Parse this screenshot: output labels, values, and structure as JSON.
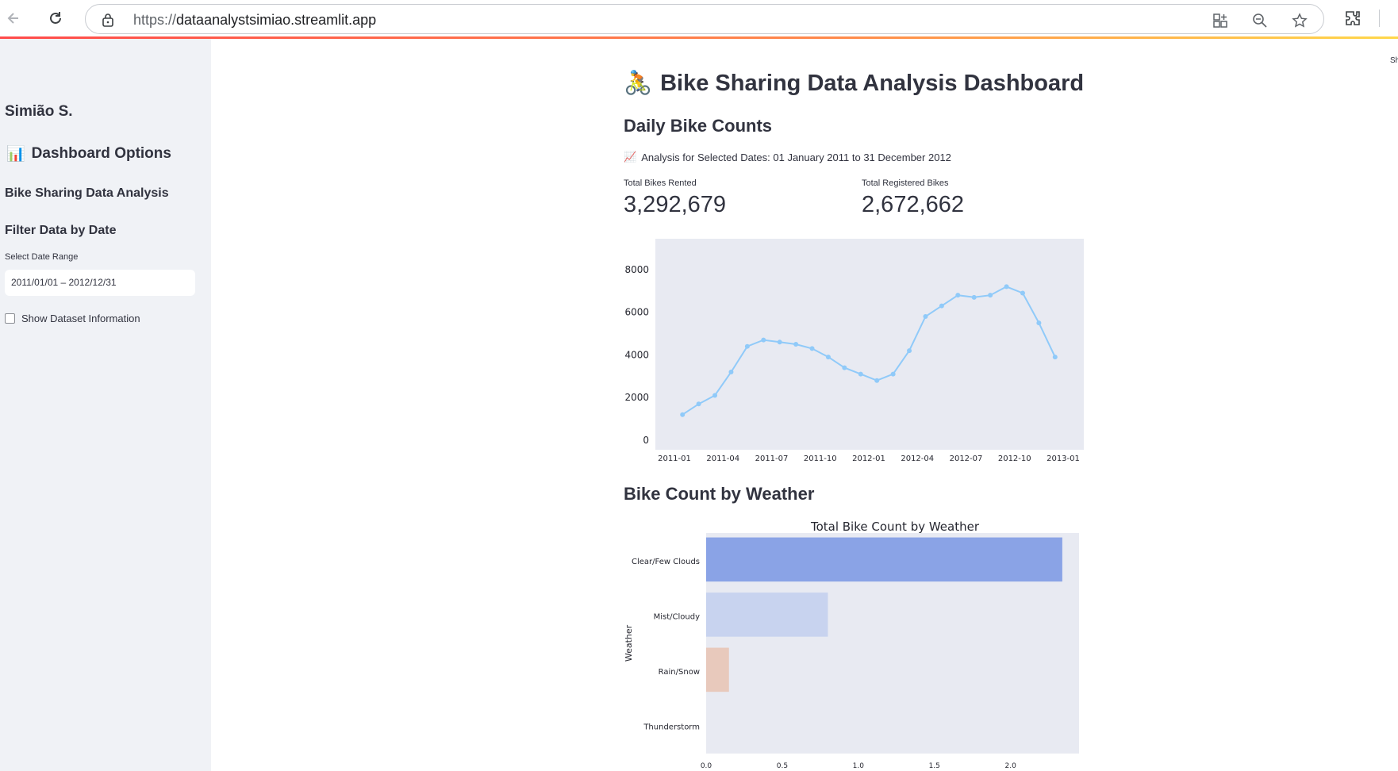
{
  "browser": {
    "url_prefix": "https://",
    "url_domain": "dataanalystsimiao.streamlit.app",
    "icons": [
      "back-arrow-icon",
      "reload-icon",
      "lock-icon",
      "apps-icon",
      "zoom-icon",
      "star-icon",
      "extensions-icon"
    ]
  },
  "sidebar": {
    "author": "Simião S.",
    "options_icon": "📊",
    "options_title": "Dashboard Options",
    "section_title": "Bike Sharing Data Analysis",
    "filter_title": "Filter Data by Date",
    "date_label": "Select Date Range",
    "date_value": "2011/01/01 – 2012/12/31",
    "checkbox_label": "Show Dataset Information",
    "checkbox_checked": false
  },
  "main": {
    "title_icon": "🚴",
    "title": "Bike Sharing Data Analysis Dashboard",
    "daily_heading": "Daily Bike Counts",
    "caption_icon": "📈",
    "caption": "Analysis for Selected Dates: 01 January 2011 to 31 December 2012",
    "metrics": [
      {
        "label": "Total Bikes Rented",
        "value": "3,292,679"
      },
      {
        "label": "Total Registered Bikes",
        "value": "2,672,662"
      }
    ],
    "weather_heading": "Bike Count by Weather",
    "top_right_text": "Sh"
  },
  "chart_data": [
    {
      "type": "line",
      "title": "",
      "xlabel": "",
      "ylabel": "",
      "color": "#90caf9",
      "background": "#e8eaf2",
      "x_ticks": [
        "2011-01",
        "2011-04",
        "2011-07",
        "2011-10",
        "2012-01",
        "2012-04",
        "2012-07",
        "2012-10",
        "2013-01"
      ],
      "y_ticks": [
        0,
        2000,
        4000,
        6000,
        8000
      ],
      "ylim": [
        0,
        9000
      ],
      "x": [
        "2011-01",
        "2011-02",
        "2011-03",
        "2011-04",
        "2011-05",
        "2011-06",
        "2011-07",
        "2011-08",
        "2011-09",
        "2011-10",
        "2011-11",
        "2011-12",
        "2012-01",
        "2012-02",
        "2012-03",
        "2012-04",
        "2012-05",
        "2012-06",
        "2012-07",
        "2012-08",
        "2012-09",
        "2012-10",
        "2012-11",
        "2012-12"
      ],
      "values": [
        1200,
        1700,
        2100,
        3200,
        4400,
        4700,
        4600,
        4500,
        4300,
        3900,
        3400,
        3100,
        2800,
        3100,
        4200,
        5800,
        6300,
        6800,
        6700,
        6800,
        7200,
        6900,
        5500,
        3900
      ]
    },
    {
      "type": "bar",
      "orientation": "horizontal",
      "title": "Total Bike Count by Weather",
      "xlabel": "",
      "ylabel": "Weather",
      "background": "#e8eaf2",
      "categories": [
        "Clear/Few Clouds",
        "Mist/Cloudy",
        "Rain/Snow",
        "Thunderstorm"
      ],
      "values": [
        2.34,
        0.8,
        0.15,
        0.0
      ],
      "colors": [
        "#8aa3e6",
        "#c8d3ef",
        "#e8c9bc",
        "#e8eaf2"
      ],
      "x_ticks": [
        "0.0",
        "0.5",
        "1.0",
        "1.5",
        "2.0"
      ],
      "xlim": [
        0,
        2.45
      ]
    }
  ]
}
